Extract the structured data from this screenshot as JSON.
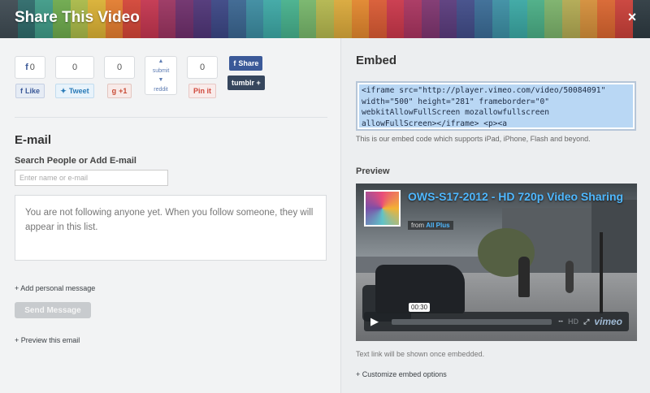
{
  "header": {
    "title": "Share This Video",
    "close_label": "×",
    "stripe_colors": [
      "#3e4a52",
      "#2e6a6a",
      "#3f9a87",
      "#6da94c",
      "#a9b948",
      "#d9b034",
      "#e27c2f",
      "#d24537",
      "#c3354f",
      "#9a3460",
      "#6e2f6b",
      "#4f3577",
      "#3b4684",
      "#3a6590",
      "#3c8ba0",
      "#3da7a4",
      "#46b08c",
      "#76b56a",
      "#b3b64e",
      "#d9a83a",
      "#e1862d",
      "#d85a33",
      "#c9374a",
      "#a8345f",
      "#7e356f",
      "#5a3b7c",
      "#414c88",
      "#3a6b95",
      "#3c8ea3",
      "#3aa7a3",
      "#4aad85",
      "#7bb16a",
      "#b1a952",
      "#d38e3a",
      "#d8652f",
      "#c94039",
      "#2e3a41"
    ]
  },
  "share": {
    "facebook": {
      "count": "0",
      "label": "Like"
    },
    "twitter": {
      "count": "0",
      "label": "Tweet"
    },
    "google": {
      "count": "0",
      "label": "+1"
    },
    "reddit": {
      "top": "submit",
      "label": "reddit"
    },
    "pinterest": {
      "count": "0",
      "label": "Pin it"
    },
    "facebook_share": "Share",
    "tumblr": "tumblr +"
  },
  "email": {
    "heading": "E-mail",
    "search_heading": "Search People or Add E-mail",
    "search_placeholder": "Enter name or e-mail",
    "empty_text": "You are not following anyone yet. When you follow someone, they will appear in this list.",
    "add_message": "+ Add personal message",
    "send_button": "Send Message",
    "preview_email": "+ Preview this email"
  },
  "embed": {
    "heading": "Embed",
    "code": "<iframe src=\"http://player.vimeo.com/video/50084091\"\nwidth=\"500\" height=\"281\" frameborder=\"0\"\nwebkitAllowFullScreen mozallowfullscreen\nallowFullScreen></iframe> <p><a",
    "note": "This is our embed code which supports iPad, iPhone, Flash and beyond.",
    "preview_heading": "Preview",
    "text_link_note": "Text link will be shown once embedded.",
    "customize": "+ Customize embed options"
  },
  "video": {
    "title": "OWS-S17-2012 - HD 720p Video Sharing",
    "byline_from": "from",
    "byline_user": "All Plus",
    "time": "00:30",
    "play_icon": "▶",
    "ctl_one": "ⵈ",
    "ctl_hd": "HD",
    "ctl_full": "⤢",
    "brand": "vimeo"
  }
}
